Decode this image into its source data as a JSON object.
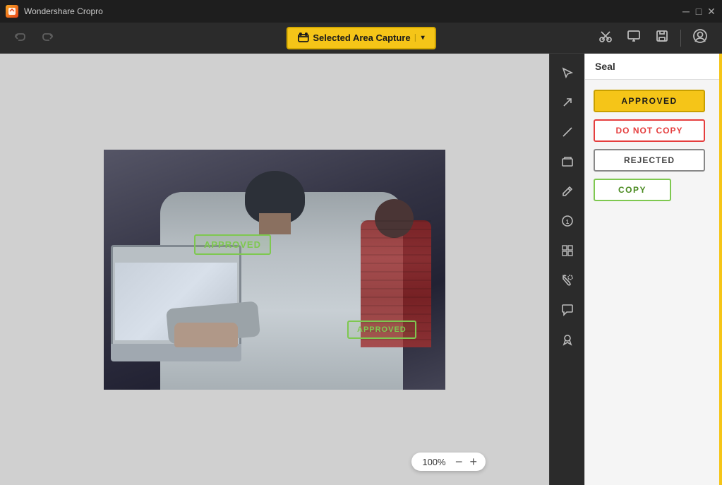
{
  "titlebar": {
    "app_name": "Wondershare Cropro",
    "buttons": [
      "minimize",
      "restore",
      "close"
    ]
  },
  "toolbar": {
    "undo_label": "↺",
    "redo_label": "↻",
    "capture_label": "Selected Area Capture",
    "capture_dropdown": "▾",
    "cut_icon": "✂",
    "monitor_icon": "⬜",
    "save_icon": "💾",
    "profile_icon": "👤"
  },
  "right_toolbar": {
    "tools": [
      {
        "name": "edit",
        "icon": "✎"
      },
      {
        "name": "arrow",
        "icon": "↗"
      },
      {
        "name": "line",
        "icon": "/"
      },
      {
        "name": "shape",
        "icon": "◱"
      },
      {
        "name": "pen",
        "icon": "✏"
      },
      {
        "name": "number",
        "icon": "①"
      },
      {
        "name": "mosaic",
        "icon": "▦"
      },
      {
        "name": "paint",
        "icon": "🖌"
      },
      {
        "name": "speech",
        "icon": "💬"
      },
      {
        "name": "ribbon",
        "icon": "🎗"
      }
    ]
  },
  "canvas": {
    "zoom_level": "100%",
    "zoom_minus": "−",
    "zoom_plus": "+"
  },
  "stamps": {
    "approved_1_text": "APPROVED",
    "approved_2_text": "APPROVED"
  },
  "seal_panel": {
    "title": "Seal",
    "items": [
      {
        "label": "APPROVED",
        "type": "approved"
      },
      {
        "label": "DO NOT COPY",
        "type": "donotcopy"
      },
      {
        "label": "REJECTED",
        "type": "rejected"
      },
      {
        "label": "COPY",
        "type": "copy"
      }
    ]
  }
}
